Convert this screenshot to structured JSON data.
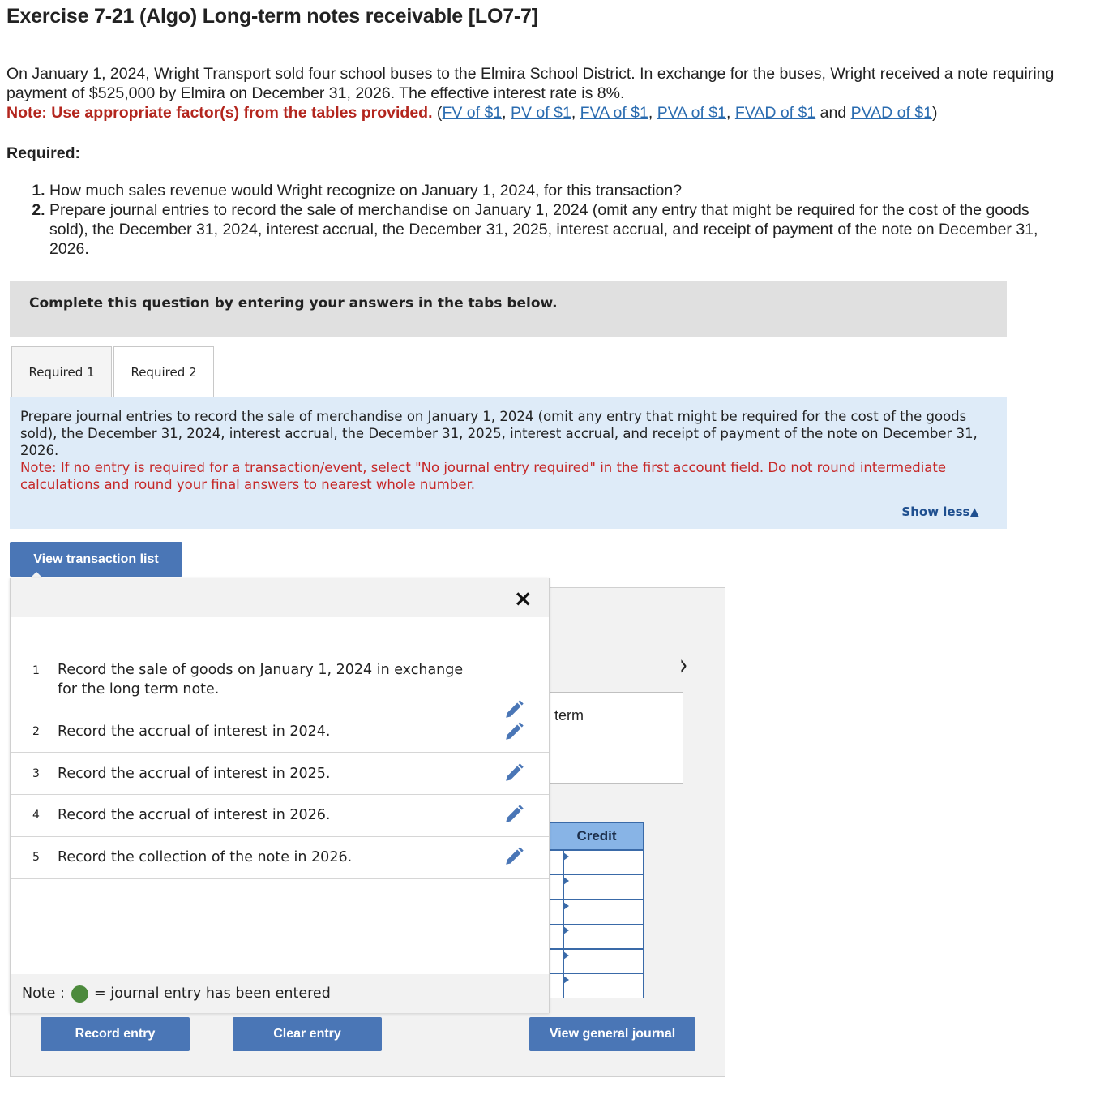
{
  "page": {
    "title": "Exercise 7-21 (Algo) Long-term notes receivable [LO7-7]"
  },
  "intro": {
    "paragraph": "On January 1, 2024, Wright Transport sold four school buses to the Elmira School District. In exchange for the buses, Wright received a note requiring payment of $525,000 by Elmira on December 31, 2026. The effective interest rate is 8%.",
    "note": "Note: Use appropriate factor(s) from the tables provided.",
    "links": {
      "open": " (",
      "fv": "FV of $1",
      "pv": "PV of $1",
      "fva": "FVA of $1",
      "pva": "PVA of $1",
      "fvad": "FVAD of $1",
      "and": " and ",
      "pvad": "PVAD of $1",
      "close": ")",
      "sep": ", "
    }
  },
  "required": {
    "heading": "Required:",
    "items": [
      "How much sales revenue would Wright recognize on January 1, 2024, for this transaction?",
      "Prepare journal entries to record the sale of merchandise on January 1, 2024 (omit any entry that might be required for the cost of the goods sold), the December 31, 2024, interest accrual, the December 31, 2025, interest accrual, and receipt of payment of the note on December 31, 2026."
    ]
  },
  "banner": {
    "text": "Complete this question by entering your answers in the tabs below."
  },
  "tabs": [
    {
      "label": "Required 1"
    },
    {
      "label": "Required 2"
    }
  ],
  "instructions": {
    "text": "Prepare journal entries to record the sale of merchandise on January 1, 2024 (omit any entry that might be required for the cost of the goods sold), the December 31, 2024, interest accrual, the December 31, 2025, interest accrual, and receipt of payment of the note on December 31, 2026.",
    "note": "Note: If no entry is required for a transaction/event, select \"No journal entry required\" in the first account field. Do not round intermediate calculations and round your final answers to nearest whole number.",
    "show_less": "Show less▲"
  },
  "buttons": {
    "view_transaction_list": "View transaction list",
    "record_entry": "Record entry",
    "clear_entry": "Clear entry",
    "view_general_journal": "View general journal"
  },
  "popup": {
    "close": "×",
    "transactions": [
      {
        "num": "1",
        "text": "Record the sale of goods on January 1, 2024 in exchange for the long term note."
      },
      {
        "num": "2",
        "text": "Record the accrual of interest in 2024."
      },
      {
        "num": "3",
        "text": "Record the accrual of interest in 2025."
      },
      {
        "num": "4",
        "text": "Record the accrual of interest in 2026."
      },
      {
        "num": "5",
        "text": "Record the collection of the note in 2026."
      }
    ],
    "note_label": "Note :",
    "note_text": "= journal entry has been entered",
    "note_dot_color": "#4c8a3c"
  },
  "journal": {
    "description_fragment": "term",
    "credit_header": "Credit",
    "next_icon": "›"
  },
  "colors": {
    "accent_blue": "#4a76b6",
    "note_red": "#b3261e",
    "link_blue": "#2b6cb0"
  }
}
